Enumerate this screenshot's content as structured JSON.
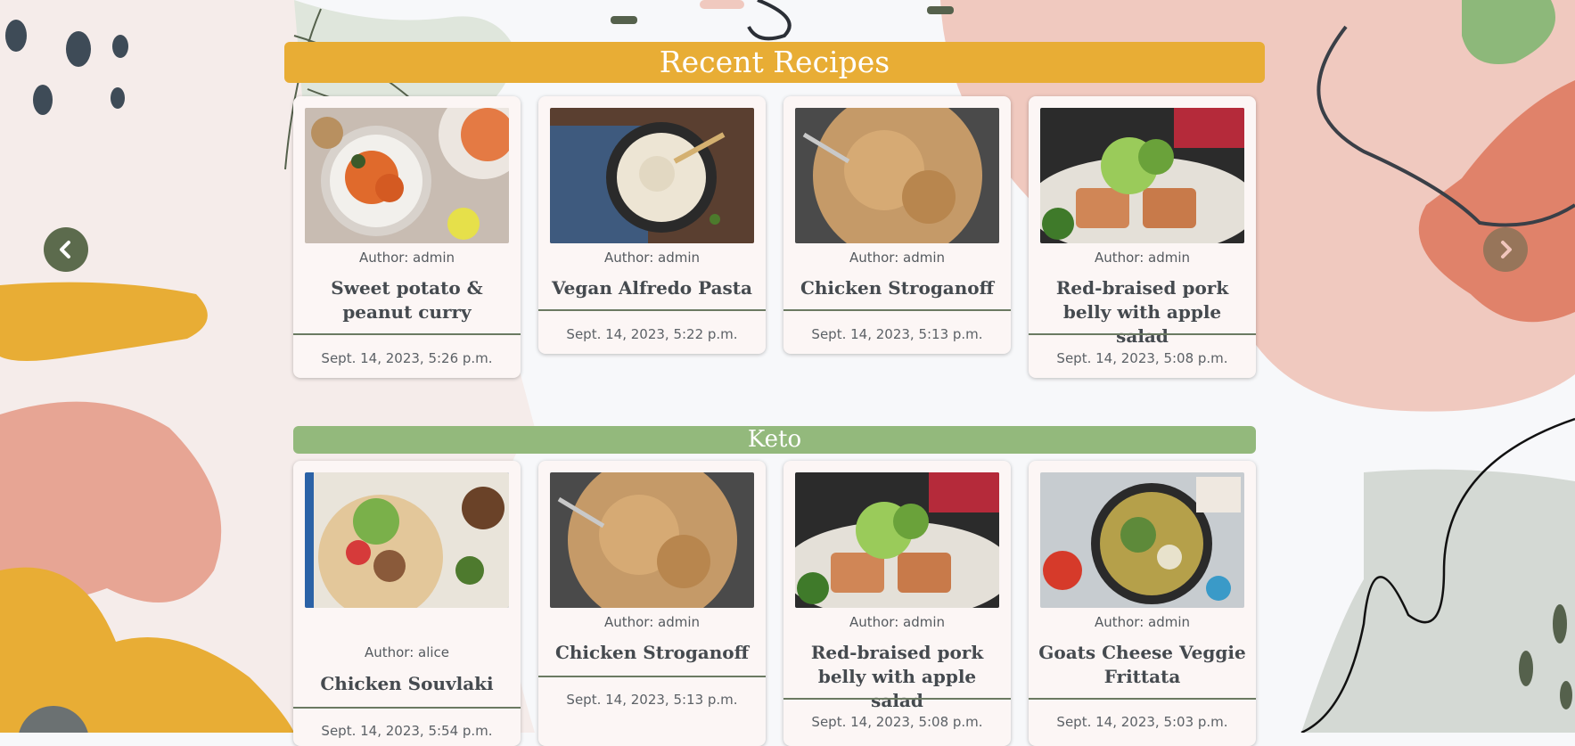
{
  "sections": [
    {
      "heading": "Recent Recipes",
      "cards": [
        {
          "author": "Author: admin",
          "title": "Sweet potato & peanut curry",
          "date": "Sept. 14, 2023, 5:26 p.m.",
          "image": "curry-photo"
        },
        {
          "author": "Author: admin",
          "title": "Vegan Alfredo Pasta",
          "date": "Sept. 14, 2023, 5:22 p.m.",
          "image": "pasta-photo"
        },
        {
          "author": "Author: admin",
          "title": "Chicken Stroganoff",
          "date": "Sept. 14, 2023, 5:13 p.m.",
          "image": "stroganoff-photo"
        },
        {
          "author": "Author: admin",
          "title": "Red-braised pork belly with apple salad",
          "date": "Sept. 14, 2023, 5:08 p.m.",
          "image": "pork-belly-photo"
        }
      ]
    },
    {
      "heading": "Keto",
      "cards": [
        {
          "author": "Author: alice",
          "title": "Chicken Souvlaki",
          "date": "Sept. 14, 2023, 5:54 p.m.",
          "image": "souvlaki-photo"
        },
        {
          "author": "Author: admin",
          "title": "Chicken Stroganoff",
          "date": "Sept. 14, 2023, 5:13 p.m.",
          "image": "stroganoff-photo"
        },
        {
          "author": "Author: admin",
          "title": "Red-braised pork belly with apple salad",
          "date": "Sept. 14, 2023, 5:08 p.m.",
          "image": "pork-belly-photo"
        },
        {
          "author": "Author: admin",
          "title": "Goats Cheese Veggie Frittata",
          "date": "Sept. 14, 2023, 5:03 p.m.",
          "image": "frittata-photo"
        }
      ]
    }
  ],
  "carousel": {
    "prev_icon": "chevron-left-icon",
    "next_icon": "chevron-right-icon"
  },
  "colors": {
    "recent_header": "#e8ad35",
    "keto_header": "#93b97c",
    "arrow": "#5c6b4d",
    "card": "#fcf6f5"
  }
}
